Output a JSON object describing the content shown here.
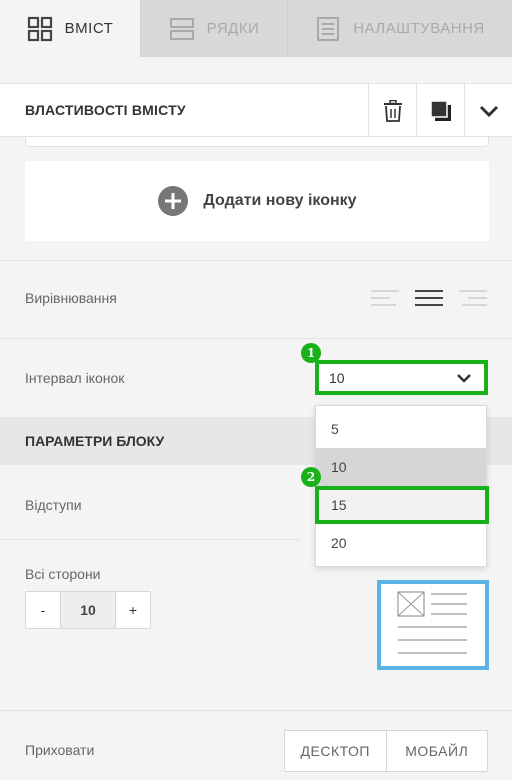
{
  "tabs": [
    {
      "label": "ВМІСТ",
      "icon": "grid-icon",
      "active": true
    },
    {
      "label": "РЯДКИ",
      "icon": "rows-icon",
      "active": false
    },
    {
      "label": "НАЛАШТУВАННЯ",
      "icon": "settings-page-icon",
      "active": false
    }
  ],
  "properties": {
    "title": "ВЛАСТИВОСТІ ВМІСТУ",
    "actions": [
      "trash-icon",
      "duplicate-icon",
      "chevron-down-icon"
    ]
  },
  "add_icon": {
    "label": "Додати нову іконку",
    "icon": "plus-circle-icon"
  },
  "alignment": {
    "label": "Вирівнювання",
    "options": [
      "align-left-icon",
      "align-center-icon",
      "align-right-icon"
    ]
  },
  "icon_spacing": {
    "label": "Інтервал іконок",
    "value": "10",
    "options": [
      "5",
      "10",
      "15",
      "20"
    ],
    "selected": "10",
    "highlighted": "15"
  },
  "markers": [
    "1",
    "2"
  ],
  "block_params": {
    "title": "ПАРАМЕТРИ БЛОКУ"
  },
  "padding": {
    "label": "Відступи",
    "all_sides_label": "Всі сторони",
    "minus": "-",
    "value": "10",
    "plus": "+"
  },
  "hide": {
    "label": "Приховати",
    "options": [
      "ДЕСКТОП",
      "МОБАЙЛ"
    ]
  },
  "colors": {
    "accent_green": "#19b119",
    "preview_border": "#5ab4e5"
  }
}
